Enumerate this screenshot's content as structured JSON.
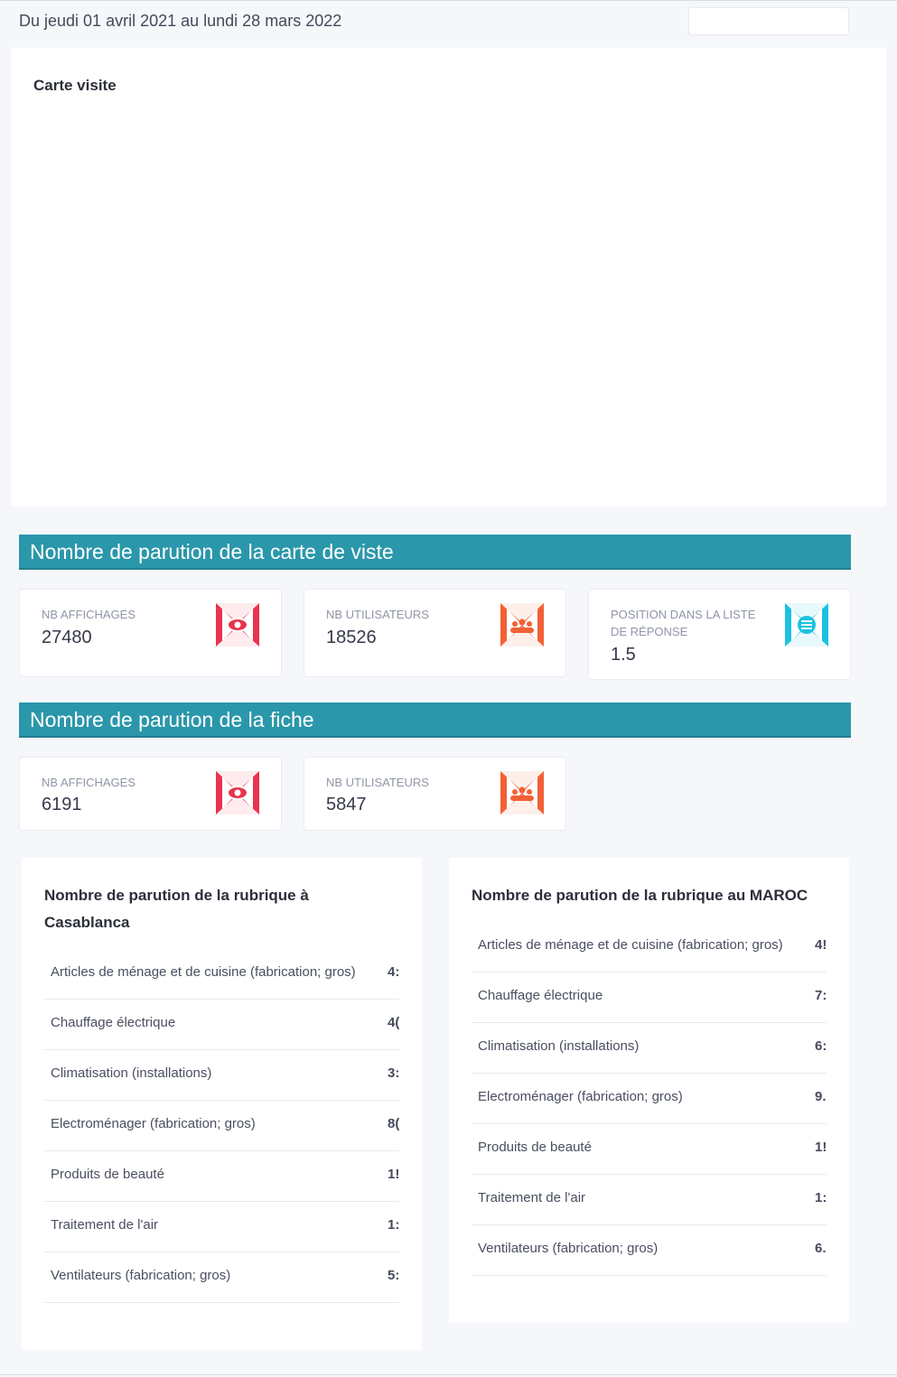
{
  "header": {
    "date_range": "Du jeudi 01 avril 2021 au lundi 28 mars 2022"
  },
  "map_card": {
    "title": "Carte visite"
  },
  "section_carte": {
    "title": "Nombre de parution de la carte de viste",
    "stats": [
      {
        "label": "NB AFFICHAGES",
        "value": "27480",
        "icon": "eye-icon",
        "color": "#e8344e"
      },
      {
        "label": "NB UTILISATEURS",
        "value": "18526",
        "icon": "users-icon",
        "color": "#f26135"
      },
      {
        "label": "POSITION DANS LA LISTE DE RÉPONSE",
        "value": "1.5",
        "icon": "list-icon",
        "color": "#1bc2e0"
      }
    ]
  },
  "section_fiche": {
    "title": "Nombre de parution de la fiche",
    "stats": [
      {
        "label": "NB AFFICHAGES",
        "value": "6191",
        "icon": "eye-icon",
        "color": "#e8344e"
      },
      {
        "label": "NB UTILISATEURS",
        "value": "5847",
        "icon": "users-icon",
        "color": "#f26135"
      }
    ]
  },
  "rubrique_casablanca": {
    "title": "Nombre de parution de la rubrique à Casablanca",
    "rows": [
      {
        "name": "Articles de ménage et de cuisine (fabrication; gros)",
        "value": "4:"
      },
      {
        "name": "Chauffage électrique",
        "value": "4("
      },
      {
        "name": "Climatisation (installations)",
        "value": "3:"
      },
      {
        "name": "Electroménager (fabrication; gros)",
        "value": "8("
      },
      {
        "name": "Produits de beauté",
        "value": "1!"
      },
      {
        "name": "Traitement de l'air",
        "value": "1:"
      },
      {
        "name": "Ventilateurs (fabrication; gros)",
        "value": "5:"
      }
    ]
  },
  "rubrique_maroc": {
    "title": "Nombre de parution de la rubrique au MAROC",
    "rows": [
      {
        "name": "Articles de ménage et de cuisine (fabrication; gros)",
        "value": "4!"
      },
      {
        "name": "Chauffage électrique",
        "value": "7:"
      },
      {
        "name": "Climatisation (installations)",
        "value": "6:"
      },
      {
        "name": "Electroménager (fabrication; gros)",
        "value": "9."
      },
      {
        "name": "Produits de beauté",
        "value": "1!"
      },
      {
        "name": "Traitement de l'air",
        "value": "1:"
      },
      {
        "name": "Ventilateurs (fabrication; gros)",
        "value": "6."
      }
    ]
  }
}
